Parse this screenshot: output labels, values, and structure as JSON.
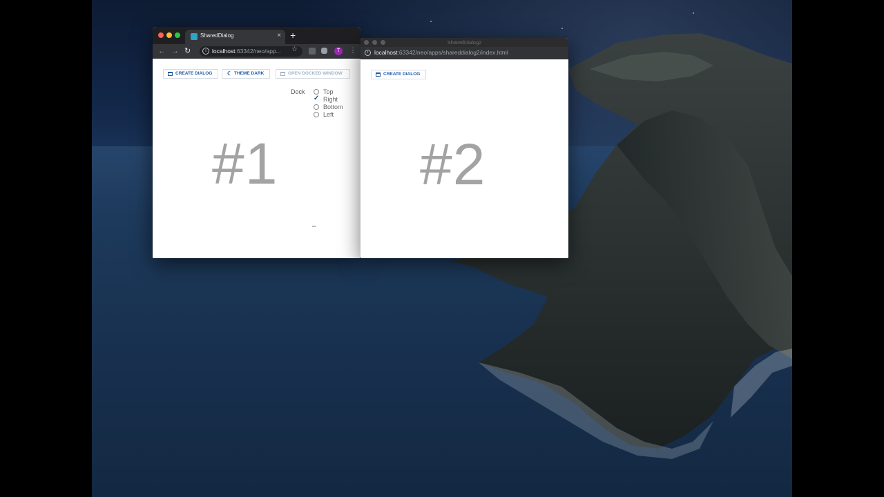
{
  "window1": {
    "tab_title": "SharedDialog",
    "tab_close": "×",
    "new_tab": "+",
    "url_host": "localhost",
    "url_rest": ":63342/neo/app...",
    "avatar_letter": "T",
    "buttons": {
      "create_dialog": "CREATE DIALOG",
      "theme_dark": "THEME DARK",
      "open_docked_window": "OPEN DOCKED WINDOW"
    },
    "dock": {
      "label": "Dock",
      "options": [
        "Top",
        "Right",
        "Bottom",
        "Left"
      ],
      "selected": "Right"
    },
    "big_number": "#1"
  },
  "window2": {
    "title": "SharedDialog2",
    "url_host": "localhost",
    "url_rest": ":63342/neo/apps/shareddialog2/index.html",
    "buttons": {
      "create_dialog": "CREATE DIALOG"
    },
    "big_number": "#2"
  },
  "colors": {
    "accent_blue": "#1c5aa8",
    "big_number_gray": "#a3a3a3",
    "chrome_dark": "#35363a",
    "avatar_purple": "#9c27b0",
    "traffic_red": "#ff5f57",
    "traffic_yellow": "#febc2e",
    "traffic_green": "#28c840"
  }
}
